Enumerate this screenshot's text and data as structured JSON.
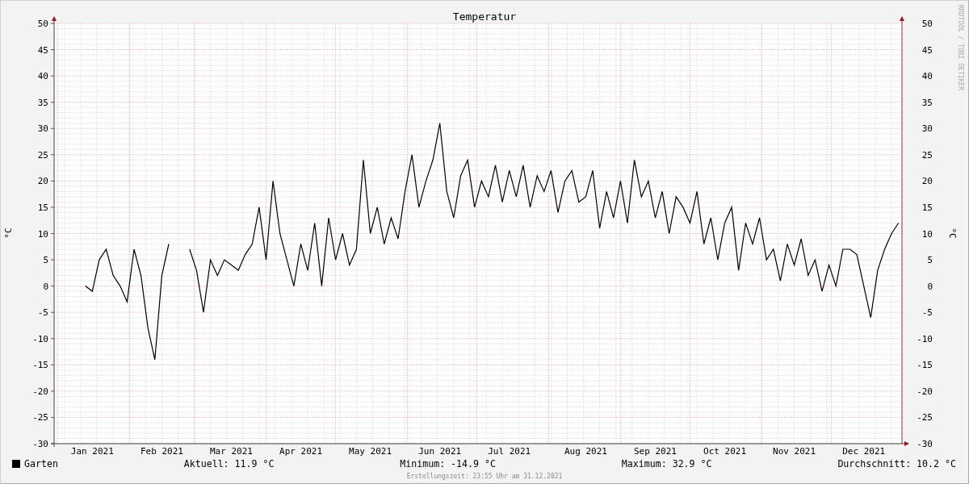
{
  "graph": {
    "chart_data": {
      "type": "line",
      "grid": true,
      "title": "Temperatur",
      "ylabel": "°C",
      "ylim": [
        -30,
        50
      ],
      "categories": [
        null,
        null,
        null,
        null,
        null,
        "Jan 2021",
        null,
        null,
        null,
        null,
        null,
        null,
        null,
        null,
        null,
        "Feb 2021",
        null,
        null,
        null,
        null,
        null,
        null,
        null,
        null,
        null,
        "Mar 2021",
        null,
        null,
        null,
        null,
        null,
        null,
        null,
        null,
        null,
        "Apr 2021",
        null,
        null,
        null,
        null,
        null,
        null,
        null,
        null,
        null,
        "May 2021",
        null,
        null,
        null,
        null,
        null,
        null,
        null,
        null,
        null,
        "Jun 2021",
        null,
        null,
        null,
        null,
        null,
        null,
        null,
        null,
        null,
        "Jul 2021",
        null,
        null,
        null,
        null,
        null,
        null,
        null,
        null,
        null,
        null,
        "Aug 2021",
        null,
        null,
        null,
        null,
        null,
        null,
        null,
        null,
        null,
        "Sep 2021",
        null,
        null,
        null,
        null,
        null,
        null,
        null,
        null,
        null,
        "Oct 2021",
        null,
        null,
        null,
        null,
        null,
        null,
        null,
        null,
        null,
        "Nov 2021",
        null,
        null,
        null,
        null,
        null,
        null,
        null,
        null,
        null,
        "Dec 2021",
        null,
        null,
        null,
        null,
        null
      ],
      "yticks": [
        50,
        45,
        40,
        35,
        30,
        25,
        20,
        15,
        10,
        5,
        0,
        -5,
        -10,
        -15,
        -20,
        -25,
        -30
      ],
      "series": [
        {
          "name": "Garten",
          "color": "#000000",
          "values": [
            null,
            null,
            null,
            null,
            0,
            -1,
            5,
            7,
            2,
            0,
            -3,
            7,
            2,
            -8,
            -14,
            2,
            8,
            null,
            null,
            7,
            3,
            -5,
            5,
            2,
            5,
            4,
            3,
            6,
            8,
            15,
            5,
            20,
            10,
            5,
            0,
            8,
            3,
            12,
            0,
            13,
            5,
            10,
            4,
            7,
            24,
            10,
            15,
            8,
            13,
            9,
            18,
            25,
            15,
            20,
            24,
            31,
            18,
            13,
            21,
            24,
            15,
            20,
            17,
            23,
            16,
            22,
            17,
            23,
            15,
            21,
            18,
            22,
            14,
            20,
            22,
            16,
            17,
            22,
            11,
            18,
            13,
            20,
            12,
            24,
            17,
            20,
            13,
            18,
            10,
            17,
            15,
            12,
            18,
            8,
            13,
            5,
            12,
            15,
            3,
            12,
            8,
            13,
            5,
            7,
            1,
            8,
            4,
            9,
            2,
            5,
            -1,
            4,
            0,
            7,
            7,
            6,
            0,
            -6,
            3,
            7,
            10,
            12
          ]
        }
      ]
    },
    "right_axis": {
      "ylabel": "°C",
      "ticks": [
        "50",
        "45",
        "40",
        "35",
        "30",
        "25",
        "20",
        "15",
        "10",
        "5",
        "0",
        "-5",
        "-10",
        "-15",
        "-20",
        "-25",
        "-30"
      ]
    },
    "credit": "RRDTOOL / TOBI OETIKER"
  },
  "legend": {
    "current": "Aktuell: 11.9 °C",
    "minimum": "Minimum: -14.9 °C",
    "maximum": "Maximum: 32.9 °C",
    "average": "Durchschnitt: 10.2 °C"
  },
  "footer": "Erstellungszeit: 23:55 Uhr am 31.12.2021"
}
